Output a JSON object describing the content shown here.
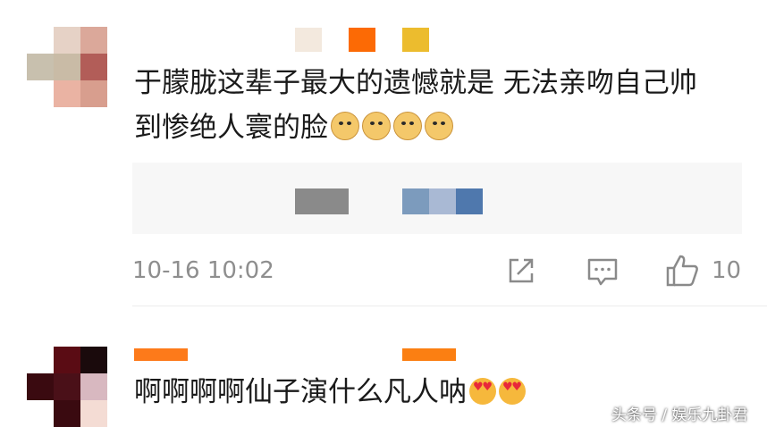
{
  "comments": [
    {
      "text": "于朦胧这辈子最大的遗憾就是 无法亲吻自己帅到惨绝人寰的脸",
      "emojis": [
        "doge-emoji",
        "doge-emoji",
        "doge-emoji",
        "doge-emoji"
      ]
    },
    {
      "text": "啊啊啊啊仙子演什么凡人呐",
      "emojis": [
        "heart-eyes-emoji",
        "heart-eyes-emoji"
      ]
    }
  ],
  "meta": {
    "timestamp": "10-16 10:02",
    "like_count": "10"
  },
  "icons": [
    "share-icon",
    "reply-icon",
    "like-icon"
  ],
  "watermark": "头条号 / 娱乐九卦君",
  "colors": {
    "text": "#1a1a1a",
    "meta": "#8e8e8e",
    "quote_bg": "#f7f7f7"
  }
}
